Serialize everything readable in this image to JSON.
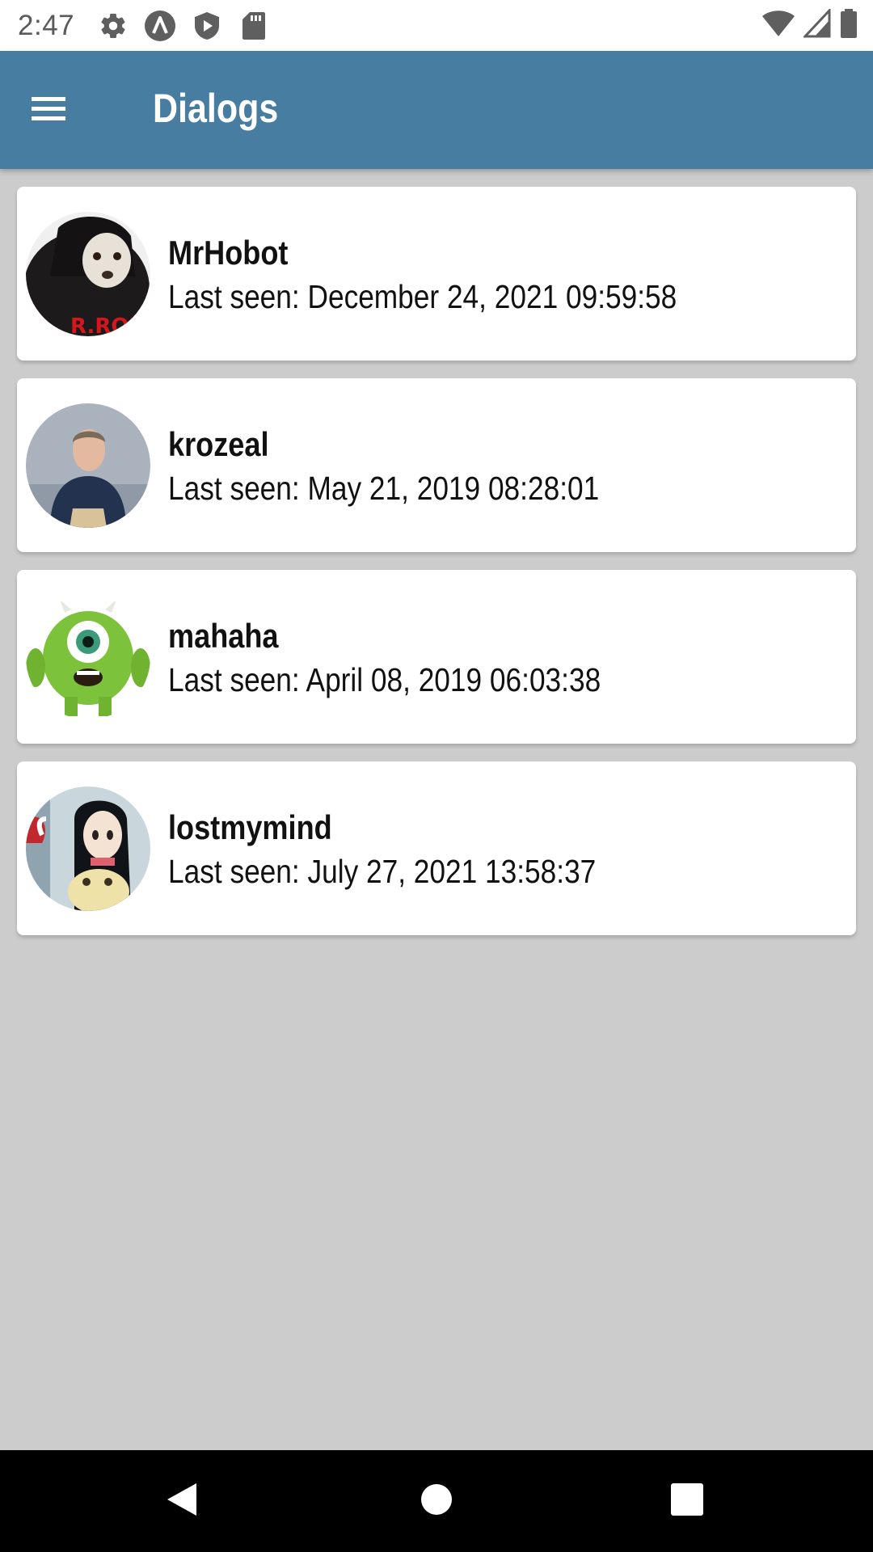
{
  "status_bar": {
    "time": "2:47",
    "icons_left": [
      "settings-gear-icon",
      "android-a-icon",
      "shield-play-icon",
      "sd-card-icon"
    ],
    "icons_right": [
      "wifi-icon",
      "cell-signal-icon",
      "battery-icon"
    ]
  },
  "app_bar": {
    "title": "Dialogs",
    "menu_icon": "hamburger-menu-icon",
    "color": "#467da1"
  },
  "dialogs": [
    {
      "name": "MrHobot",
      "last_seen": "Last seen: December 24, 2021 09:59:58",
      "avatar": "dog-hoodie-avatar"
    },
    {
      "name": "krozeal",
      "last_seen": "Last seen: May 21, 2019 08:28:01",
      "avatar": "man-hoodie-avatar"
    },
    {
      "name": "mahaha",
      "last_seen": "Last seen: April 08, 2019 06:03:38",
      "avatar": "green-monster-avatar"
    },
    {
      "name": "lostmymind",
      "last_seen": "Last seen: July 27, 2021 13:58:37",
      "avatar": "anime-girl-avatar"
    }
  ],
  "nav_bar": {
    "icons": [
      "back-triangle-icon",
      "home-circle-icon",
      "recents-square-icon"
    ]
  },
  "colors": {
    "background": "#cccccc",
    "card": "#ffffff",
    "text": "#111111"
  }
}
